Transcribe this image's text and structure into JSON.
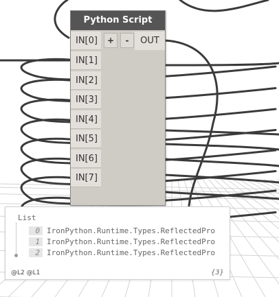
{
  "node": {
    "title": "Python Script",
    "inputs": [
      "IN[0]",
      "IN[1]",
      "IN[2]",
      "IN[3]",
      "IN[4]",
      "IN[5]",
      "IN[6]",
      "IN[7]"
    ],
    "add_label": "+",
    "remove_label": "-",
    "output": "OUT"
  },
  "preview": {
    "title": "List",
    "items": [
      {
        "index": "0",
        "value": "IronPython.Runtime.Types.ReflectedPro"
      },
      {
        "index": "1",
        "value": "IronPython.Runtime.Types.ReflectedPro"
      },
      {
        "index": "2",
        "value": "IronPython.Runtime.Types.ReflectedPro"
      }
    ],
    "levels": "@L2 @L1",
    "count": "{3}"
  },
  "colors": {
    "wire": "#3a3a3a",
    "grid": "#d4d4d4",
    "node_header": "#555555",
    "node_body": "#cfcbc5"
  }
}
